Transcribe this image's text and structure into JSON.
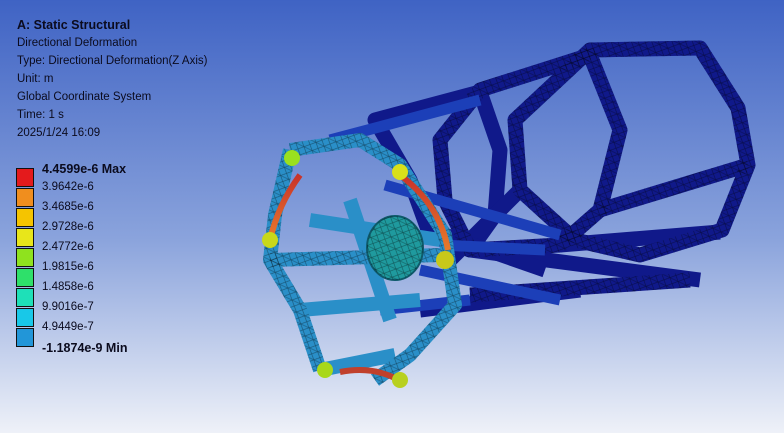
{
  "info": {
    "title": "A: Static Structural",
    "result": "Directional Deformation",
    "type": "Type: Directional Deformation(Z Axis)",
    "unit": "Unit: m",
    "coordinate_system": "Global Coordinate System",
    "time": "Time: 1 s",
    "date": "2025/1/24 16:09"
  },
  "legend": {
    "max_label": "4.4599e-6 Max",
    "min_label": "-1.1874e-9 Min",
    "values": [
      "3.9642e-6",
      "3.4685e-6",
      "2.9728e-6",
      "2.4772e-6",
      "1.9815e-6",
      "1.4858e-6",
      "9.9016e-7",
      "4.9449e-7"
    ],
    "colors": [
      "#e41a1c",
      "#f08e1e",
      "#f5c400",
      "#e8e61a",
      "#8fe21e",
      "#2ee06a",
      "#1ee0b8",
      "#18c8e8",
      "#2296d8",
      "#1020c8"
    ]
  }
}
